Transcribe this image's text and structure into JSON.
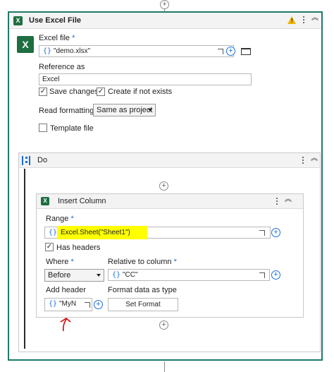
{
  "use_excel_file": {
    "title": "Use Excel File",
    "excel_file_label": "Excel file",
    "required_mark": "*",
    "excel_file_value": "\"demo.xlsx\"",
    "reference_label": "Reference as",
    "reference_value": "Excel",
    "save_changes_label": "Save changes",
    "save_changes_checked": true,
    "create_if_not_exists_label": "Create if not exists",
    "create_if_not_exists_checked": true,
    "read_formatting_label": "Read formatting",
    "read_formatting_value": "Same as project",
    "template_file_label": "Template file",
    "template_file_checked": false
  },
  "do": {
    "title": "Do"
  },
  "insert_column": {
    "title": "Insert Column",
    "range_label": "Range",
    "range_value": "Excel.Sheet(\"Sheet1\")",
    "has_headers_label": "Has headers",
    "has_headers_checked": true,
    "where_label": "Where",
    "where_value": "Before",
    "relative_label": "Relative to column",
    "relative_value": "\"CC\"",
    "add_header_label": "Add header",
    "add_header_value": "\"MyN",
    "format_label": "Format data as type",
    "set_format_label": "Set Format"
  },
  "icons": {
    "brace": "{}",
    "plus": "+",
    "check": "✓",
    "more": "more-vertical-icon",
    "collapse": "chevron-double-up-icon",
    "warning": "!"
  },
  "colors": {
    "outer_border": "#1f7a6a",
    "accent": "#1a6ed8",
    "excel_green": "#1d6f42",
    "highlight": "#ffff00",
    "annotation_red": "#d40000"
  }
}
